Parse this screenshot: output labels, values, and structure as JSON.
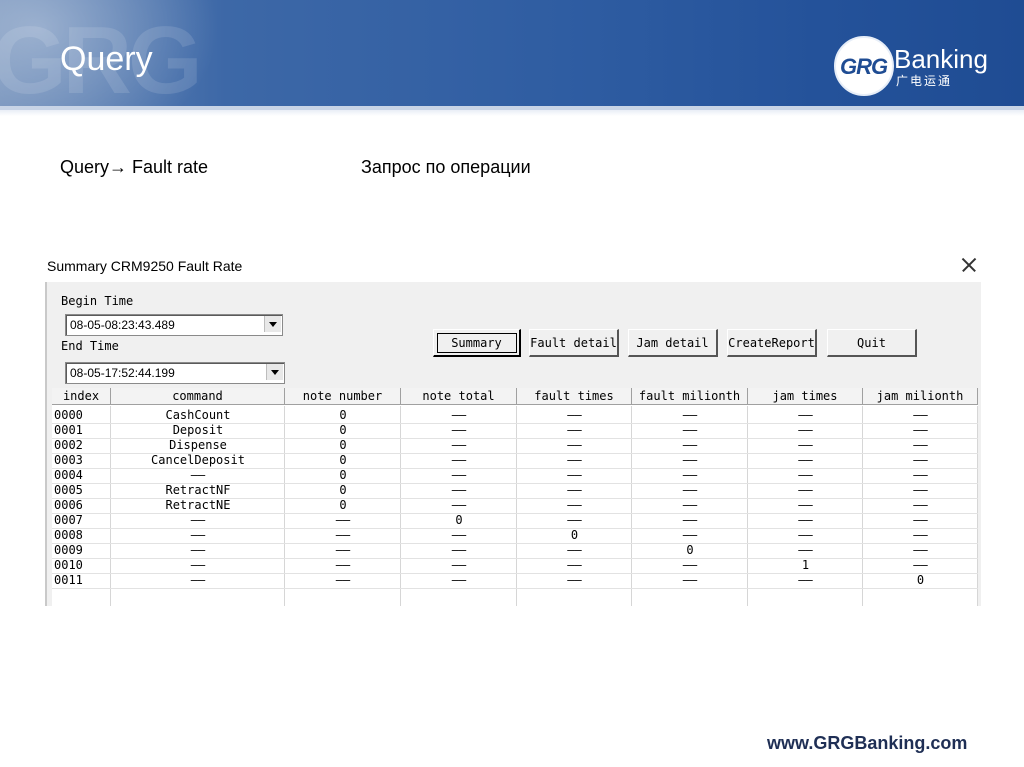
{
  "slide": {
    "title": "Query",
    "subtitle_left": "Query→ Fault rate",
    "subtitle_right": "Запрос по операции",
    "footer_url": "www.GRGBanking.com",
    "logo": {
      "mark": "GRG",
      "name": "Banking",
      "chinese": "广电运通"
    },
    "colors": {
      "banner": "#2f5da2",
      "brand": "#1f4c93"
    }
  },
  "dialog": {
    "title": "Summary CRM9250 Fault Rate",
    "begin_label": "Begin Time",
    "begin_value": "08-05-08:23:43.489",
    "end_label": "End Time",
    "end_value": "08-05-17:52:44.199",
    "buttons": {
      "summary": "Summary",
      "fault_detail": "Fault detail",
      "jam_detail": "Jam detail",
      "create_report": "CreateReport",
      "quit": "Quit"
    },
    "columns": [
      "index",
      "command",
      "note number",
      "note total",
      "fault times",
      "fault milionth",
      "jam times",
      "jam milionth"
    ],
    "rows": [
      [
        "0000",
        "CashCount",
        "0",
        "——",
        "——",
        "——",
        "——",
        "——"
      ],
      [
        "0001",
        "Deposit",
        "0",
        "——",
        "——",
        "——",
        "——",
        "——"
      ],
      [
        "0002",
        "Dispense",
        "0",
        "——",
        "——",
        "——",
        "——",
        "——"
      ],
      [
        "0003",
        "CancelDeposit",
        "0",
        "——",
        "——",
        "——",
        "——",
        "——"
      ],
      [
        "0004",
        "——",
        "0",
        "——",
        "——",
        "——",
        "——",
        "——"
      ],
      [
        "0005",
        "RetractNF",
        "0",
        "——",
        "——",
        "——",
        "——",
        "——"
      ],
      [
        "0006",
        "RetractNE",
        "0",
        "——",
        "——",
        "——",
        "——",
        "——"
      ],
      [
        "0007",
        "——",
        "——",
        "0",
        "——",
        "——",
        "——",
        "——"
      ],
      [
        "0008",
        "——",
        "——",
        "——",
        "0",
        "——",
        "——",
        "——"
      ],
      [
        "0009",
        "——",
        "——",
        "——",
        "——",
        "0",
        "——",
        "——"
      ],
      [
        "0010",
        "——",
        "——",
        "——",
        "——",
        "——",
        "1",
        "——"
      ],
      [
        "0011",
        "——",
        "——",
        "——",
        "——",
        "——",
        "——",
        "0"
      ]
    ]
  }
}
